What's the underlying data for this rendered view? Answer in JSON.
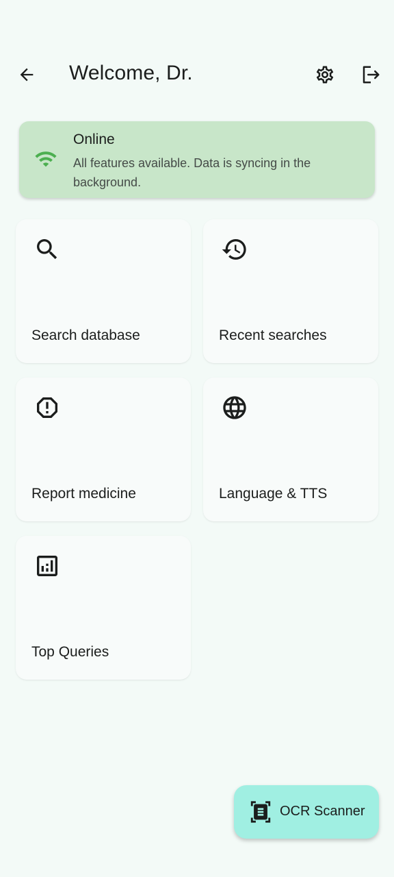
{
  "header": {
    "title": "Welcome, Dr.",
    "icons": [
      "back-arrow-icon",
      "gear-icon",
      "logout-icon"
    ]
  },
  "status": {
    "title": "Online",
    "message": "All features available. Data is syncing in the background.",
    "icon": "wifi-icon",
    "color": "#4caf50",
    "background": "#c8e6c9"
  },
  "tiles": [
    {
      "label": "Search database",
      "icon": "search-icon"
    },
    {
      "label": "Recent searches",
      "icon": "history-icon"
    },
    {
      "label": "Report medicine",
      "icon": "report-icon"
    },
    {
      "label": "Language & TTS",
      "icon": "globe-icon"
    },
    {
      "label": "Top Queries",
      "icon": "analytics-icon"
    }
  ],
  "fab": {
    "label": "OCR Scanner",
    "icon": "document-scanner-icon",
    "background": "#a0efe2"
  }
}
